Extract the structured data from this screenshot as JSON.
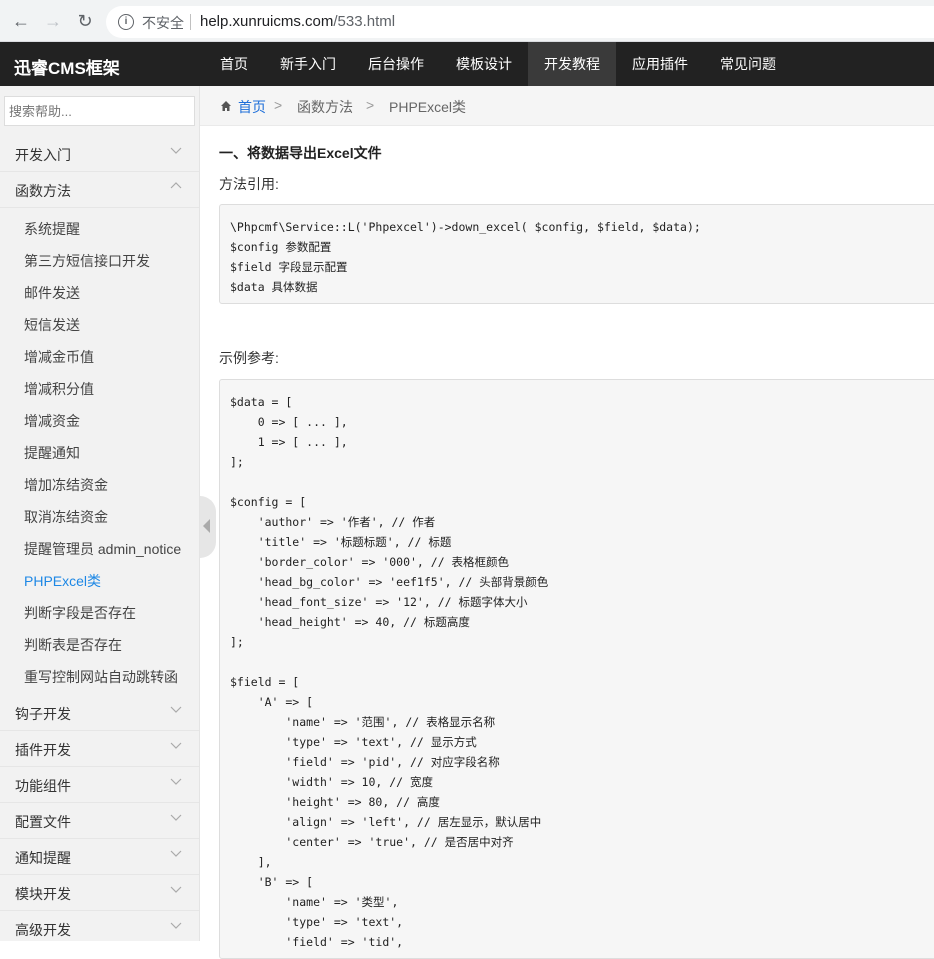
{
  "browser": {
    "insecure_label": "不安全",
    "url_host": "help.xunruicms.com",
    "url_path": "/533.html"
  },
  "topnav": {
    "logo": "迅睿CMS框架",
    "items": [
      {
        "label": "首页"
      },
      {
        "label": "新手入门"
      },
      {
        "label": "后台操作"
      },
      {
        "label": "模板设计"
      },
      {
        "label": "开发教程"
      },
      {
        "label": "应用插件"
      },
      {
        "label": "常见问题"
      }
    ],
    "active": "开发教程"
  },
  "sidebar": {
    "search_placeholder": "搜索帮助...",
    "groups_top": [
      {
        "label": "开发入门"
      },
      {
        "label": "函数方法"
      }
    ],
    "sub_items": [
      {
        "label": "系统提醒"
      },
      {
        "label": "第三方短信接口开发"
      },
      {
        "label": "邮件发送"
      },
      {
        "label": "短信发送"
      },
      {
        "label": "增减金币值"
      },
      {
        "label": "增减积分值"
      },
      {
        "label": "增减资金"
      },
      {
        "label": "提醒通知"
      },
      {
        "label": "增加冻结资金"
      },
      {
        "label": "取消冻结资金"
      },
      {
        "label": "提醒管理员 admin_notice"
      },
      {
        "label": "PHPExcel类"
      },
      {
        "label": "判断字段是否存在"
      },
      {
        "label": "判断表是否存在"
      },
      {
        "label": "重写控制网站自动跳转函"
      }
    ],
    "groups_bottom": [
      {
        "label": "钩子开发"
      },
      {
        "label": "插件开发"
      },
      {
        "label": "功能组件"
      },
      {
        "label": "配置文件"
      },
      {
        "label": "通知提醒"
      },
      {
        "label": "模块开发"
      },
      {
        "label": "高级开发"
      }
    ]
  },
  "breadcrumb": {
    "home": "首页",
    "sep": ">",
    "parent": "函数方法",
    "current": "PHPExcel类"
  },
  "content": {
    "section_title": "一、将数据导出Excel文件",
    "label_method": "方法引用:",
    "code_method": "\\Phpcmf\\Service::L('Phpexcel')->down_excel( $config, $field, $data);\n$config 参数配置\n$field 字段显示配置\n$data 具体数据",
    "label_example": "示例参考:",
    "code_example": "$data = [\n    0 => [ ... ],\n    1 => [ ... ],\n];\n\n$config = [\n    'author' => '作者', // 作者\n    'title' => '标题标题', // 标题\n    'border_color' => '000', // 表格框颜色\n    'head_bg_color' => 'eef1f5', // 头部背景颜色\n    'head_font_size' => '12', // 标题字体大小\n    'head_height' => 40, // 标题高度\n];\n\n$field = [\n    'A' => [\n        'name' => '范围', // 表格显示名称\n        'type' => 'text', // 显示方式\n        'field' => 'pid', // 对应字段名称\n        'width' => 10, // 宽度\n        'height' => 80, // 高度\n        'align' => 'left', // 居左显示，默认居中\n        'center' => 'true', // 是否居中对齐\n    ],\n    'B' => [\n        'name' => '类型',\n        'type' => 'text',\n        'field' => 'tid',"
  }
}
